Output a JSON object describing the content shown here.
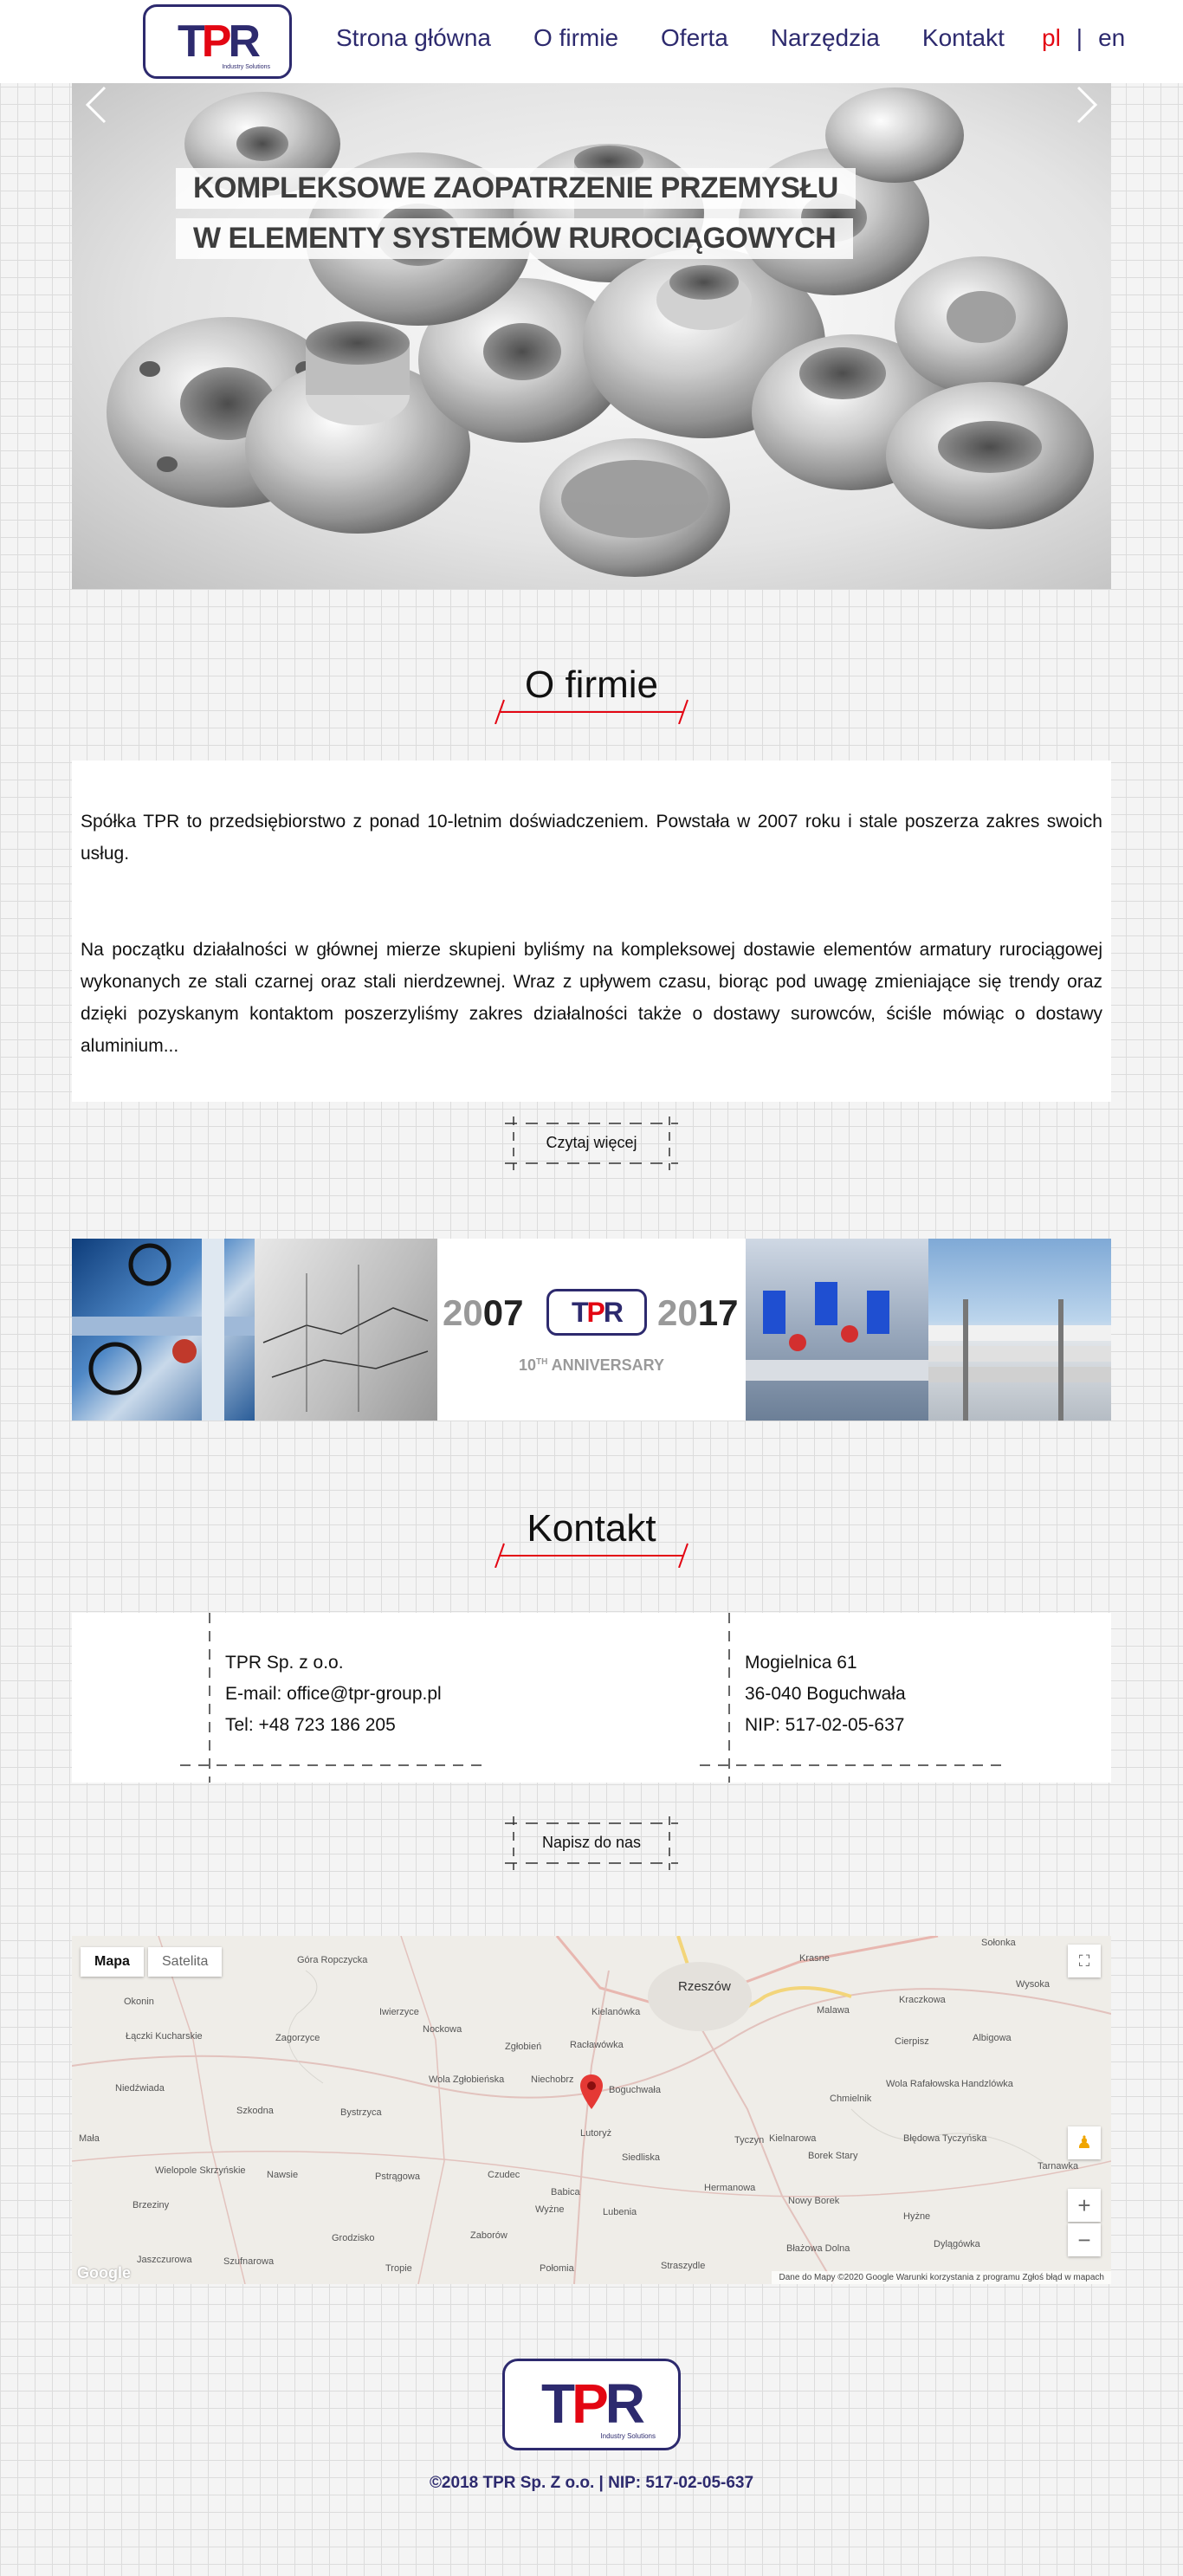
{
  "header": {
    "logo_text_left": "T",
    "logo_text_mid": "P",
    "logo_text_right": "R",
    "logo_tagline": "Industry Solutions",
    "nav": [
      "Strona główna",
      "O firmie",
      "Oferta",
      "Narzędzia",
      "Kontakt"
    ],
    "lang_pl": "pl",
    "lang_sep": "|",
    "lang_en": "en"
  },
  "hero": {
    "line1": "KOMPLEKSOWE ZAOPATRZENIE PRZEMYSŁU",
    "line2": "W ELEMENTY SYSTEMÓW RUROCIĄGOWYCH"
  },
  "about": {
    "title": "O firmie",
    "p1": "Spółka TPR to przedsiębiorstwo z ponad 10-letnim doświadczeniem. Powstała w 2007 roku i stale poszerza zakres swoich usług.",
    "p2": "Na początku działalności w głównej mierze skupieni byliśmy na kompleksowej dostawie elementów armatury rurociągowej wykonanych ze stali czarnej oraz stali nierdzewnej. Wraz z upływem czasu, biorąc pod uwagę zmieniające się trendy oraz dzięki pozyskanym kontaktom poszerzyliśmy zakres działalności także o dostawy surowców, ściśle mówiąc o dostawy aluminium...",
    "more_label": "Czytaj więcej"
  },
  "anniversary": {
    "year_start_a": "20",
    "year_start_b": "07",
    "year_end_a": "20",
    "year_end_b": "17",
    "label": "ANNIVERSARY",
    "ordinal": "10",
    "ordinal_sup": "TH"
  },
  "contact": {
    "title": "Kontakt",
    "company": "TPR Sp. z o.o.",
    "email": "E-mail: office@tpr-group.pl",
    "phone": "Tel: +48 723 186 205",
    "street": "Mogielnica 61",
    "city": "36-040 Boguchwała",
    "nip": "NIP: 517-02-05-637",
    "write_label": "Napisz do nas"
  },
  "map": {
    "tab_map": "Mapa",
    "tab_satellite": "Satelita",
    "zoom_in": "+",
    "zoom_out": "−",
    "places": [
      "Góra Ropczycka",
      "Okonin",
      "Iwierzyce",
      "Nockowa",
      "Kielanówka",
      "Rzeszów",
      "Krasne",
      "Łączki Kucharskie",
      "Zagorzyce",
      "Zgłobień",
      "Racławówka",
      "Malawa",
      "Kraczkowa",
      "Wysoka",
      "Niedźwiada",
      "Wola Zgłobieńska",
      "Niechobrz",
      "Boguchwała",
      "Cierpisz",
      "Albigowa",
      "Szkodna",
      "Bystrzyca",
      "Lutoryż",
      "Chmielnik",
      "Wola Rafałowska",
      "Handzlówka",
      "Mała",
      "Wielopole Skrzyńskie",
      "Nawsie",
      "Pstrągowa",
      "Czudec",
      "Siedliska",
      "Tyczyn",
      "Kielnarowa",
      "Borek Stary",
      "Błędowa Tyczyńska",
      "Brzeziny",
      "Babica",
      "Wyżne",
      "Lubenia",
      "Hermanowa",
      "Nowy Borek",
      "Hyżne",
      "Tarnawka",
      "Grodzisko",
      "Zaborów",
      "Jaszczurowa",
      "Szufnarowa",
      "Tropie",
      "Połomia",
      "Straszydle",
      "Błażowa Dolna",
      "Dylągówka",
      "Sołonka"
    ],
    "footer": "Dane do Mapy ©2020 Google   Warunki korzystania z programu   Zgłoś błąd w mapach",
    "google": "Google"
  },
  "footer": {
    "copyright": "©2018 TPR Sp. Z o.o. | NIP: 517-02-05-637"
  },
  "colors": {
    "brand_navy": "#2d2a6e",
    "brand_red": "#e30613"
  }
}
